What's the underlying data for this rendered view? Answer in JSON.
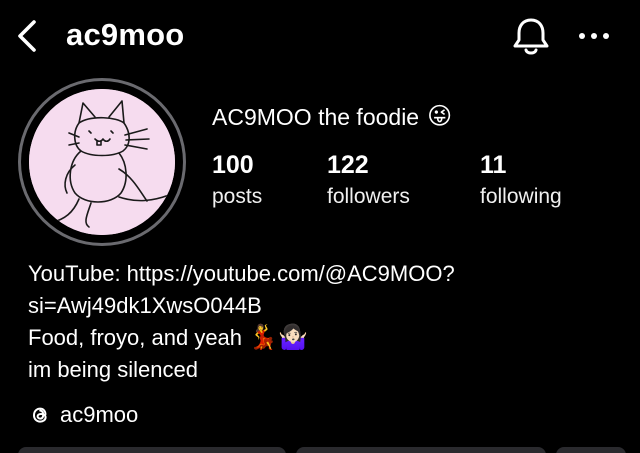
{
  "header": {
    "username": "ac9moo",
    "back_icon": "chevron-left-icon",
    "notification_icon": "bell-icon",
    "more_icon": "more-dots-icon"
  },
  "profile": {
    "display_name": "AC9MOO the foodie",
    "display_name_emoji": "😜",
    "avatar_description_icon": "cat-doodle-avatar",
    "avatar_bg": "#f6dcef"
  },
  "stats": [
    {
      "value": "100",
      "label": "posts"
    },
    {
      "value": "122",
      "label": "followers"
    },
    {
      "value": "11",
      "label": "following"
    }
  ],
  "bio": {
    "line1": "YouTube: https://youtube.com/@AC9MOO?",
    "line2": "si=Awj49dk1XwsO044B",
    "line3_text": "Food, froyo, and yeah ",
    "line3_emojis": "💃🤷🏻‍♀️",
    "line4": "im being silenced"
  },
  "threads": {
    "icon": "threads-icon",
    "handle": "ac9moo"
  },
  "colors": {
    "background": "#000000",
    "text": "#ffffff",
    "avatar_ring": "#6a6a6f",
    "button_bg": "#2a2a2e"
  }
}
